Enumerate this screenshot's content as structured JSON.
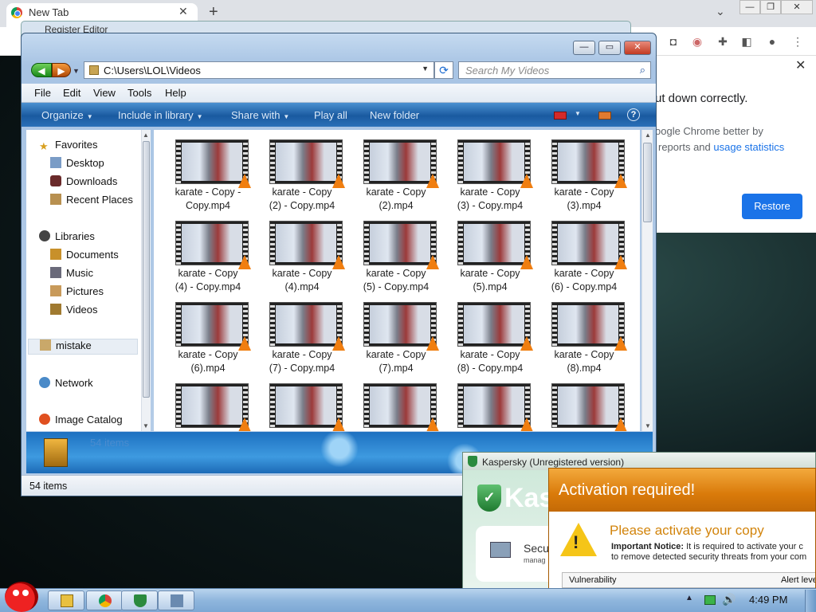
{
  "chrome": {
    "tab_title": "New Tab",
    "behind_title": "Register Editor",
    "crash_title": "ut down correctly.",
    "crash_line1": "oogle Chrome better by",
    "crash_line2_prefix": " reports and ",
    "crash_link": "usage statistics",
    "restore_label": "Restore"
  },
  "explorer": {
    "address": "C:\\Users\\LOL\\Videos",
    "search_placeholder": "Search My Videos",
    "menu": [
      "File",
      "Edit",
      "View",
      "Tools",
      "Help"
    ],
    "commands": {
      "organize": "Organize",
      "include": "Include in library",
      "share": "Share with",
      "play": "Play all",
      "newfolder": "New folder"
    },
    "nav": {
      "favorites": "Favorites",
      "desktop": "Desktop",
      "downloads": "Downloads",
      "recent": "Recent Places",
      "libraries": "Libraries",
      "documents": "Documents",
      "music": "Music",
      "pictures": "Pictures",
      "videos": "Videos",
      "mistake": "mistake",
      "network": "Network",
      "image_catalog": "Image Catalog"
    },
    "files": [
      {
        "line1": "karate - Copy -",
        "line2": "Copy.mp4"
      },
      {
        "line1": "karate - Copy",
        "line2": "(2) - Copy.mp4"
      },
      {
        "line1": "karate - Copy",
        "line2": "(2).mp4"
      },
      {
        "line1": "karate - Copy",
        "line2": "(3) - Copy.mp4"
      },
      {
        "line1": "karate - Copy",
        "line2": "(3).mp4"
      },
      {
        "line1": "karate - Copy",
        "line2": "(4) - Copy.mp4"
      },
      {
        "line1": "karate - Copy",
        "line2": "(4).mp4"
      },
      {
        "line1": "karate - Copy",
        "line2": "(5) - Copy.mp4"
      },
      {
        "line1": "karate - Copy",
        "line2": "(5).mp4"
      },
      {
        "line1": "karate - Copy",
        "line2": "(6) - Copy.mp4"
      },
      {
        "line1": "karate - Copy",
        "line2": "(6).mp4"
      },
      {
        "line1": "karate - Copy",
        "line2": "(7) - Copy.mp4"
      },
      {
        "line1": "karate - Copy",
        "line2": "(7).mp4"
      },
      {
        "line1": "karate - Copy",
        "line2": "(8) - Copy.mp4"
      },
      {
        "line1": "karate - Copy",
        "line2": "(8).mp4"
      },
      {
        "line1": "",
        "line2": ""
      },
      {
        "line1": "",
        "line2": ""
      },
      {
        "line1": "",
        "line2": ""
      },
      {
        "line1": "",
        "line2": ""
      },
      {
        "line1": "",
        "line2": ""
      }
    ],
    "details_count": "54 items",
    "status_count": "54 items"
  },
  "kaspersky": {
    "title": "Kaspersky (Unregistered version)",
    "logo_text": "Kas",
    "panel_title": "Secu",
    "panel_sub": "manag"
  },
  "activation": {
    "header": "Activation required!",
    "heading": "Please activate your copy",
    "notice_bold": "Important Notice:",
    "notice_rest": " It is required to activate your c",
    "notice_line2": "to remove detected security threats from your com",
    "col_vulnerability": "Vulnerability",
    "col_alert": "Alert leve"
  },
  "taskbar": {
    "clock": "4:49 PM"
  },
  "colors": {
    "chrome_blue": "#1a73e8",
    "explorer_cmdbar": "#1a5aa0",
    "activation_orange": "#d97a0a",
    "kaspersky_green": "#2b8a3e"
  }
}
